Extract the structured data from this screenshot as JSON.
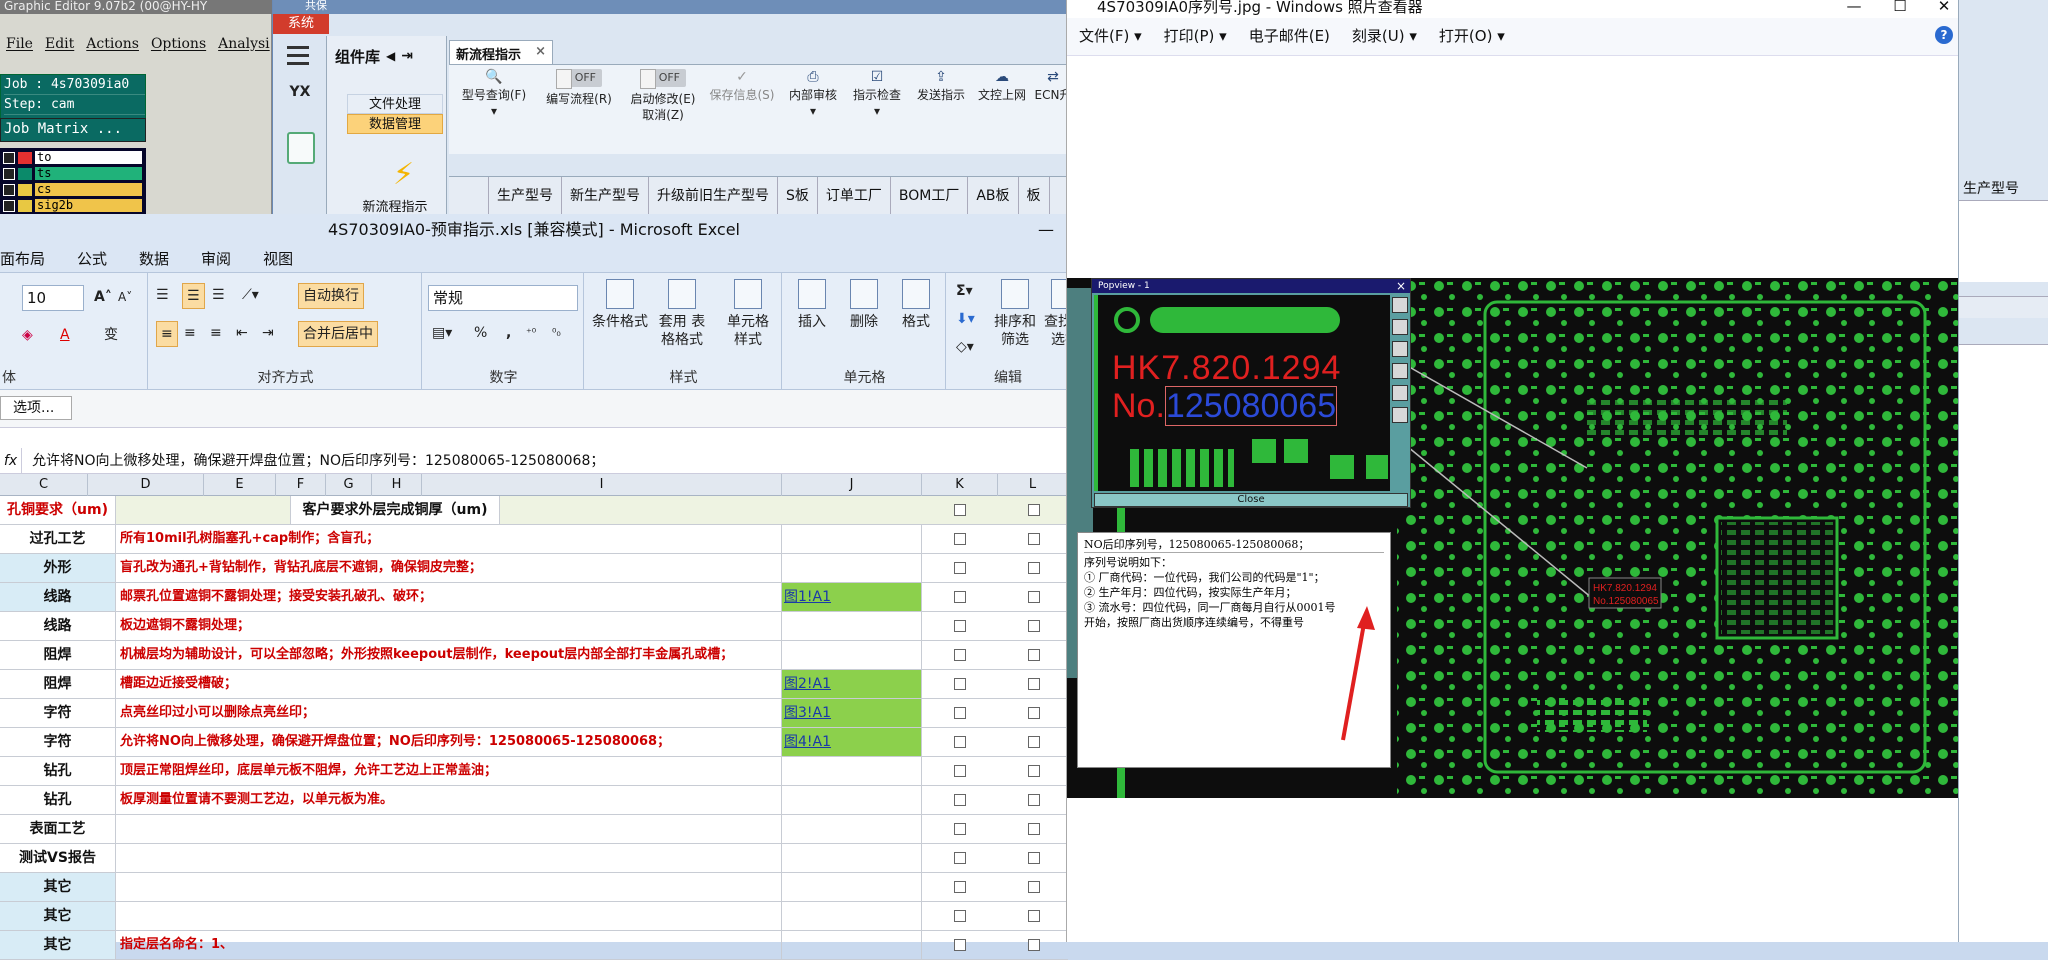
{
  "graphic_editor": {
    "title": "Graphic Editor 9.07b2 (00@HY-HY",
    "menu": [
      "File",
      "Edit",
      "Actions",
      "Options",
      "Analysi"
    ],
    "job": "Job : 4s70309ia0",
    "step": "Step: cam",
    "job_matrix": "Job Matrix ...",
    "layers": [
      {
        "name": "to",
        "color": "#e53030",
        "bg": "#ffffff"
      },
      {
        "name": "ts",
        "color": "#0b8a6a",
        "bg": "#20b27a"
      },
      {
        "name": "cs",
        "color": "#e8c842",
        "bg": "#f0c44a"
      },
      {
        "name": "sig2b",
        "color": "#e8c842",
        "bg": "#f0c44a"
      }
    ]
  },
  "sys_window": {
    "top_label": "共保",
    "sys_tab": "系统",
    "yx_label": "YX",
    "library_title": "组件库",
    "library_items": [
      "文件处理",
      "数据管理"
    ],
    "new_flow_label": "新流程指示",
    "doc_tab": "新流程指示",
    "doc_tab_close": "×",
    "toolbar": [
      {
        "label": "型号查询(F)",
        "icon": "🔍",
        "dim": false
      },
      {
        "label": "编写流程(R)",
        "icon": "OFF",
        "dim": false
      },
      {
        "label": "启动修改(E) 取消(Z)",
        "icon": "OFF",
        "dim": false
      },
      {
        "label": "保存信息(S)",
        "icon": "✓",
        "dim": true
      },
      {
        "label": "内部审核",
        "icon": "⎙",
        "dim": false
      },
      {
        "label": "指示检查",
        "icon": "☑",
        "dim": false
      },
      {
        "label": "发送指示",
        "icon": "⇪",
        "dim": false
      },
      {
        "label": "文控上网",
        "icon": "☁",
        "dim": false
      },
      {
        "label": "ECN升",
        "icon": "⇄",
        "dim": false
      }
    ],
    "grid_headers": [
      "生产型号",
      "新生产型号",
      "升级前旧生产型号",
      "S板",
      "订单工厂",
      "BOM工厂",
      "AB板",
      "板"
    ],
    "right_header": "生产型号"
  },
  "excel": {
    "title": "4S70309IA0-预审指示.xls [兼容模式] - Microsoft Excel",
    "minimize": "—",
    "tabs": [
      "面布局",
      "公式",
      "数据",
      "审阅",
      "视图"
    ],
    "font_size": "10",
    "wrap_text": "自动换行",
    "merge_center": "合并后居中",
    "number_format": "常规",
    "percent": "%",
    "comma": ",",
    "groups": {
      "font": "体",
      "alignment": "对齐方式",
      "number": "数字",
      "styles": "样式",
      "cells": "单元格",
      "edit": "编辑"
    },
    "buttons": {
      "cond_format": "条件格式",
      "table_format": "套用 表格格式",
      "cell_style": "单元格 样式",
      "insert": "插入",
      "delete": "删除",
      "format": "格式",
      "sort_filter": "排序和 筛选",
      "find_select": "查找和 选择"
    },
    "options_button": "选项...",
    "formula_fx": "fx",
    "formula": "允许将NO向上微移处理，确保避开焊盘位置；NO后印序列号：125080065-125080068；",
    "columns": [
      {
        "name": "C",
        "width": 88
      },
      {
        "name": "D",
        "width": 116
      },
      {
        "name": "E",
        "width": 72
      },
      {
        "name": "F",
        "width": 50
      },
      {
        "name": "G",
        "width": 46
      },
      {
        "name": "H",
        "width": 50
      },
      {
        "name": "I",
        "width": 282
      },
      {
        "name": "J",
        "width": 140
      },
      {
        "name": "K",
        "width": 76
      },
      {
        "name": "L",
        "width": 76
      }
    ],
    "header_row": {
      "left": "孔铜要求（um)",
      "right": "客户要求外层完成铜厚（um)"
    },
    "rows": [
      {
        "label": "过孔工艺",
        "text": "所有10mil孔树脂塞孔+cap制作；含盲孔；",
        "link": "",
        "blue": false
      },
      {
        "label": "外形",
        "text": "盲孔改为通孔+背钻制作，背钻孔底层不遮铜，确保铜皮完整；",
        "link": "",
        "blue": true
      },
      {
        "label": "线路",
        "text": "邮票孔位置遮铜不露铜处理；接受安装孔破孔、破环；",
        "link": "图1!A1",
        "blue": true
      },
      {
        "label": "线路",
        "text": "板边遮铜不露铜处理；",
        "link": "",
        "blue": false
      },
      {
        "label": "阻焊",
        "text": "机械层均为辅助设计，可以全部忽略；外形按照keepout层制作，keepout层内部全部打丰金属孔或槽；",
        "link": "",
        "blue": false
      },
      {
        "label": "阻焊",
        "text": "槽距边近接受槽破；",
        "link": "图2!A1",
        "blue": false
      },
      {
        "label": "字符",
        "text": "点亮丝印过小可以删除点亮丝印；",
        "link": "图3!A1",
        "blue": false
      },
      {
        "label": "字符",
        "text": "允许将NO向上微移处理，确保避开焊盘位置；NO后印序列号：125080065-125080068；",
        "link": "图4!A1",
        "blue": false
      },
      {
        "label": "钻孔",
        "text": "顶层正常阻焊丝印，底层单元板不阻焊，允许工艺边上正常盖油；",
        "link": "",
        "blue": false
      },
      {
        "label": "钻孔",
        "text": "板厚测量位置请不要测工艺边，以单元板为准。",
        "link": "",
        "blue": false
      },
      {
        "label": "表面工艺",
        "text": "",
        "link": "",
        "blue": false
      },
      {
        "label": "测试VS报告",
        "text": "",
        "link": "",
        "blue": false
      },
      {
        "label": "其它",
        "text": "",
        "link": "",
        "blue": true
      },
      {
        "label": "其它",
        "text": "",
        "link": "",
        "blue": true
      },
      {
        "label": "其它",
        "text": "指定层名命名：1、",
        "link": "",
        "blue": true
      }
    ]
  },
  "photo_viewer": {
    "title": "4S70309IA0序列号.jpg - Windows 照片查看器",
    "window_controls": [
      "—",
      "☐",
      "✕"
    ],
    "menu": [
      "文件(F)",
      "打印(P)",
      "电子邮件(E)",
      "刻录(U)",
      "打开(O)"
    ],
    "help": "?",
    "popview_title": "Popview - 1",
    "popview_close_x": "×",
    "popview_close": "Close",
    "marking_line1": "HK7.820.1294",
    "marking_prefix": "No.",
    "marking_serial": "125080065",
    "note_lines": [
      "NO后印序列号，125080065-125080068；",
      "序列号说明如下：",
      "① 厂商代码：一位代码，我们公司的代码是\"1\"；",
      "② 生产年月：四位代码，按实际生产年月；",
      "③ 流水号：四位代码，同一厂商每月自行从0001号",
      "开始，按照厂商出货顺序连续编号，不得重号"
    ],
    "small_marking1": "HK7.820.1294",
    "small_marking2": "No.125080065"
  },
  "colors": {
    "pcb_green": "#2fb83a",
    "pcb_bg": "#0d0d0d",
    "marking_red": "#e02020",
    "serial_blue": "#2b4ad8",
    "excel_red_text": "#cc0000",
    "link_green": "#8cd04c",
    "accent_orange": "#fcd27a"
  }
}
